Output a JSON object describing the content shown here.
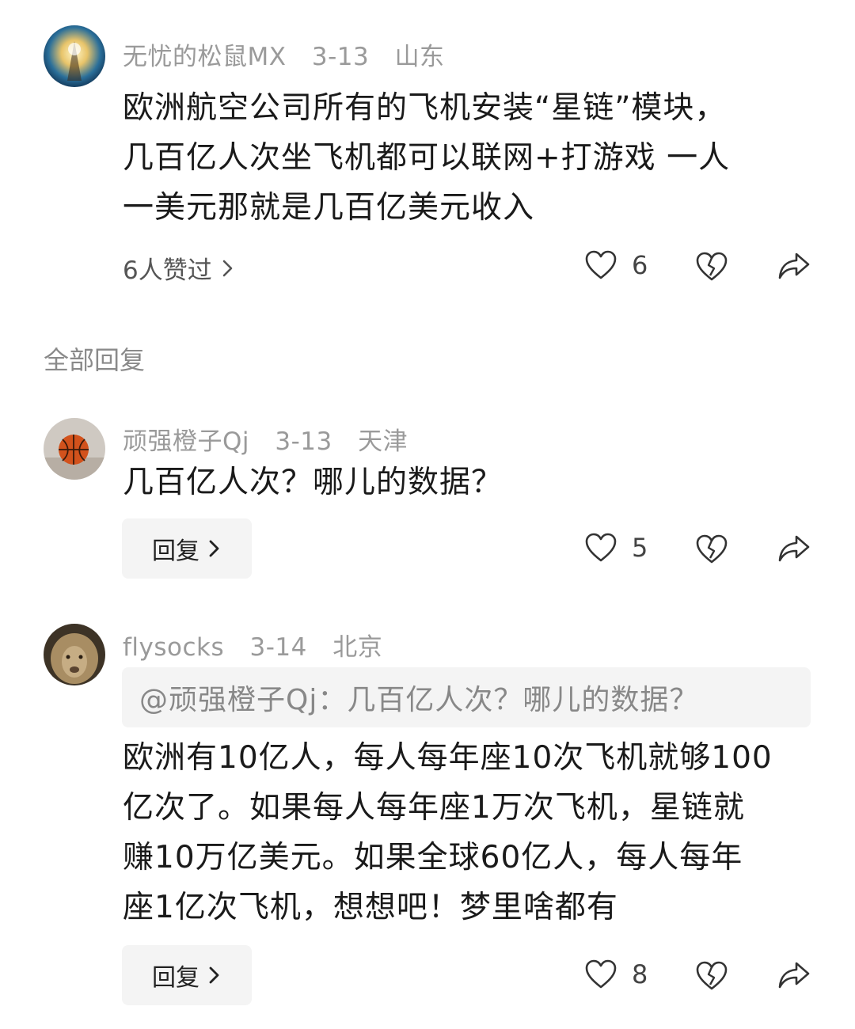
{
  "root_comment": {
    "username": "无忧的松鼠MX",
    "date": "3-13",
    "location": "山东",
    "lines": [
      "欧洲航空公司所有的飞机安装“星链”模块，",
      "几百亿人次坐飞机都可以联网+打游戏 一人",
      "一美元那就是几百亿美元收入"
    ],
    "liked_by": "6人赞过",
    "like_count": "6"
  },
  "section_title": "全部回复",
  "replies": [
    {
      "username": "顽强橙子Qj",
      "date": "3-13",
      "location": "天津",
      "lines": [
        "几百亿人次？哪儿的数据？"
      ],
      "reply_label": "回复",
      "like_count": "5"
    },
    {
      "username": "flysocks",
      "date": "3-14",
      "location": "北京",
      "quote": "@顽强橙子Qj：几百亿人次？哪儿的数据？",
      "lines": [
        "欧洲有10亿人，每人每年座10次飞机就够100",
        "亿次了。如果每人每年座1万次飞机，星链就",
        "赚10万亿美元。如果全球60亿人，每人每年",
        "座1亿次飞机，想想吧！梦里啥都有"
      ],
      "reply_label": "回复",
      "like_count": "8"
    }
  ],
  "icons": {
    "like": "heart-outline-icon",
    "dislike": "broken-heart-icon",
    "share": "share-arrow-icon",
    "more": "chevron-right-icon"
  },
  "colors": {
    "text": "#1a1a1a",
    "meta": "#9a9a9a",
    "button_bg": "#f4f4f4"
  }
}
